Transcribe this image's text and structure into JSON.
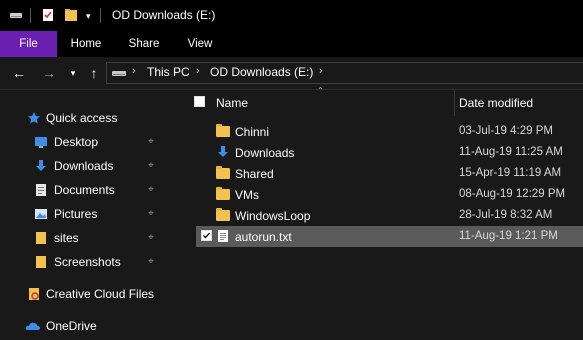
{
  "window": {
    "title": "OD Downloads  (E:)"
  },
  "ribbon": {
    "tabs": [
      {
        "label": "File"
      },
      {
        "label": "Home"
      },
      {
        "label": "Share"
      },
      {
        "label": "View"
      }
    ]
  },
  "address": {
    "crumbs": [
      {
        "label": "This PC"
      },
      {
        "label": "OD Downloads  (E:)"
      }
    ]
  },
  "nav": {
    "quick_access": "Quick access",
    "items": [
      {
        "label": "Desktop",
        "pinned": true
      },
      {
        "label": "Downloads",
        "pinned": true
      },
      {
        "label": "Documents",
        "pinned": true
      },
      {
        "label": "Pictures",
        "pinned": true
      },
      {
        "label": "sites",
        "pinned": true
      },
      {
        "label": "Screenshots",
        "pinned": true
      }
    ],
    "creative_cloud": "Creative Cloud Files",
    "onedrive": "OneDrive"
  },
  "list": {
    "columns": {
      "name": "Name",
      "date": "Date modified"
    },
    "rows": [
      {
        "name": "Chinni",
        "date": "03-Jul-19 4:29 PM",
        "type": "folder"
      },
      {
        "name": "Downloads",
        "date": "11-Aug-19 11:25 AM",
        "type": "downloads"
      },
      {
        "name": "Shared",
        "date": "15-Apr-19 11:19 AM",
        "type": "folder"
      },
      {
        "name": "VMs",
        "date": "08-Aug-19 12:29 PM",
        "type": "folder"
      },
      {
        "name": "WindowsLoop",
        "date": "28-Jul-19 8:32 AM",
        "type": "folder"
      },
      {
        "name": "autorun.txt",
        "date": "11-Aug-19 1:21 PM",
        "type": "text",
        "selected": true
      }
    ]
  },
  "colors": {
    "file_tab": "#6b1fb1",
    "background": "#191919",
    "selection": "#5a5a5a",
    "folder": "#f2c14e",
    "accent_blue": "#3d8ee8"
  }
}
